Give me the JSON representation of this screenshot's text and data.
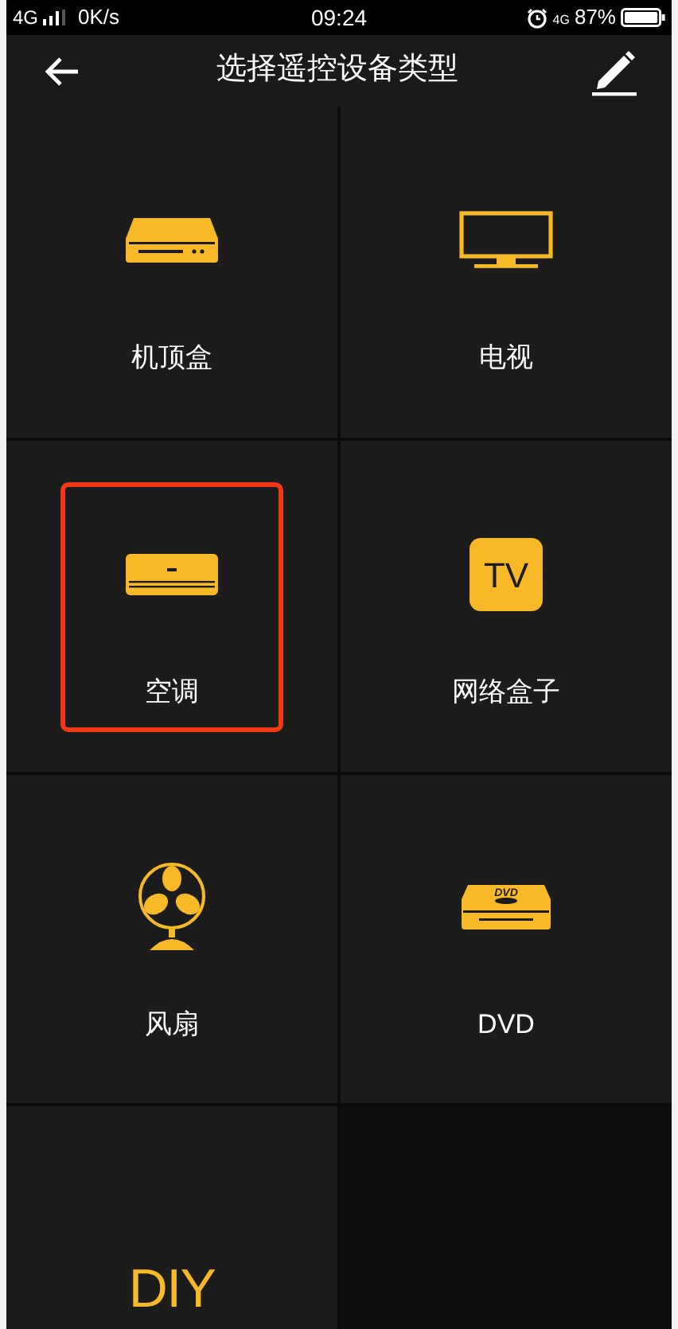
{
  "status_bar": {
    "network": "4G",
    "speed": "0K/s",
    "time": "09:24",
    "network_small": "4G",
    "battery": "87%"
  },
  "header": {
    "title": "选择遥控设备类型"
  },
  "device_rows": [
    [
      {
        "kind": "settop",
        "label": "机顶盒",
        "highlighted": false
      },
      {
        "kind": "tv",
        "label": "电视",
        "highlighted": false
      }
    ],
    [
      {
        "kind": "ac",
        "label": "空调",
        "highlighted": true
      },
      {
        "kind": "tvbox",
        "label": "网络盒子",
        "icon_text": "TV",
        "highlighted": false
      }
    ],
    [
      {
        "kind": "fan",
        "label": "风扇",
        "highlighted": false
      },
      {
        "kind": "dvd",
        "label": "DVD",
        "icon_text": "DVD",
        "highlighted": false
      }
    ],
    [
      {
        "kind": "diy",
        "icon_text": "DIY",
        "highlighted": false
      }
    ]
  ]
}
